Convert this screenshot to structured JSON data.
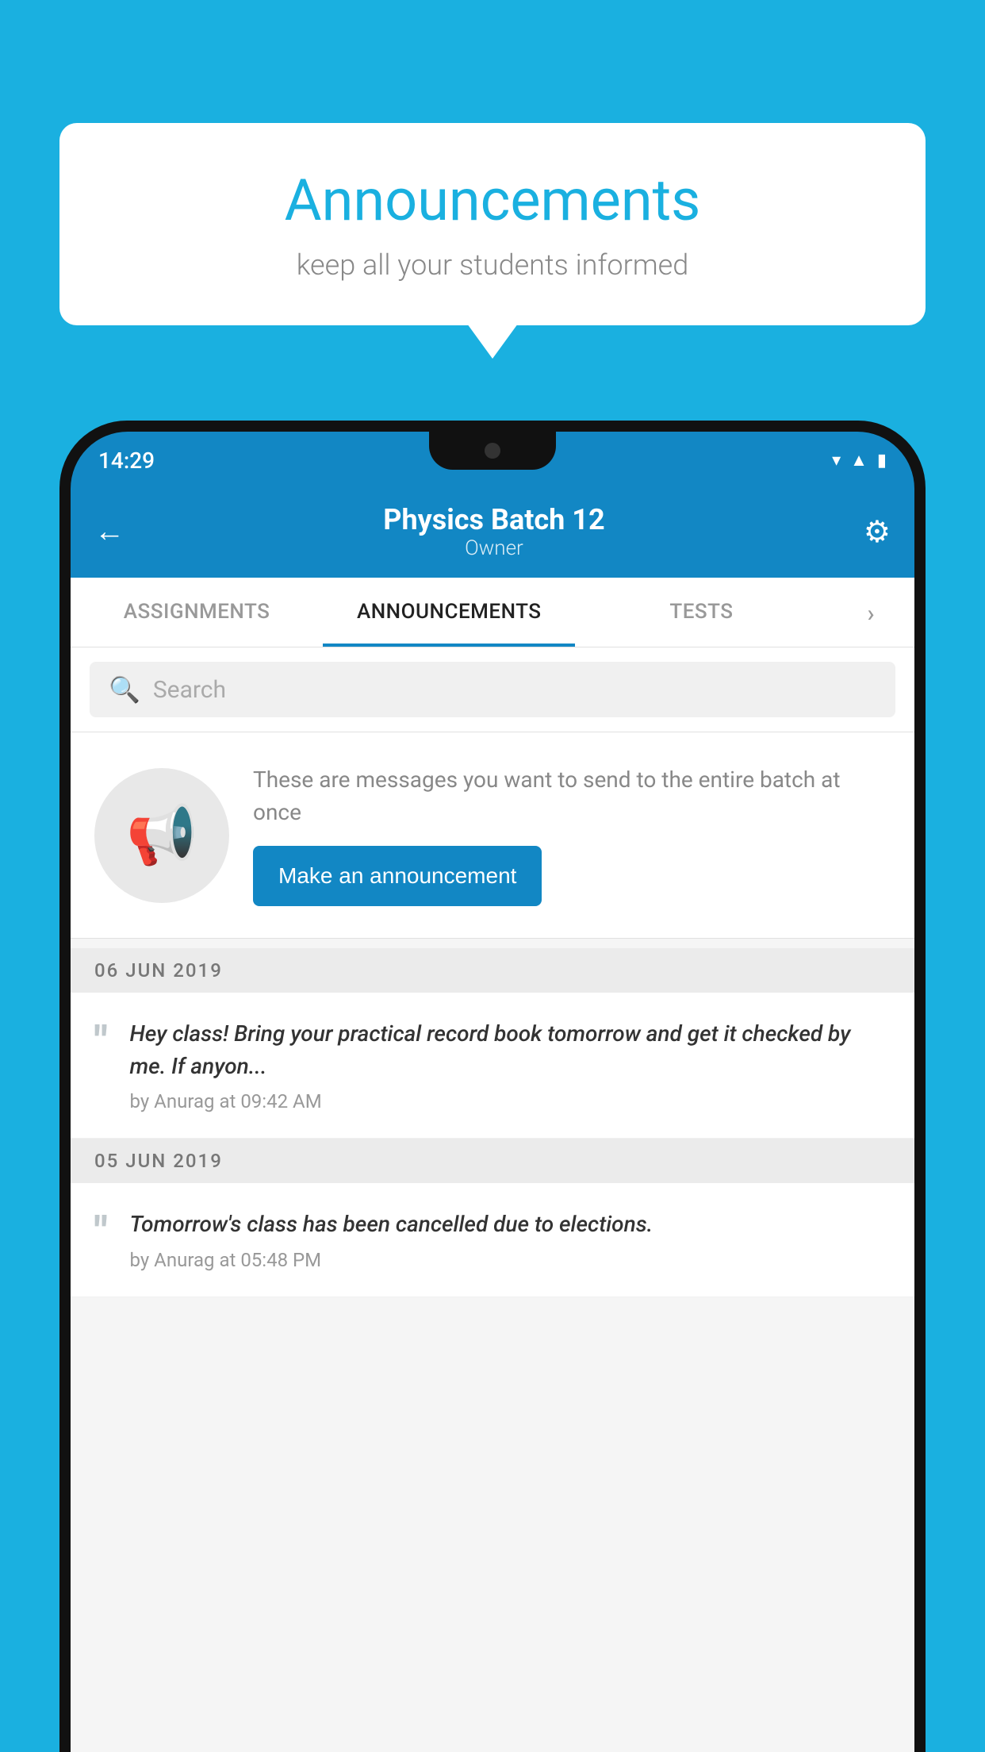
{
  "bubble": {
    "title": "Announcements",
    "subtitle": "keep all your students informed"
  },
  "status_bar": {
    "time": "14:29"
  },
  "header": {
    "title": "Physics Batch 12",
    "subtitle": "Owner",
    "back_label": "←",
    "settings_label": "⚙"
  },
  "tabs": [
    {
      "label": "ASSIGNMENTS",
      "active": false
    },
    {
      "label": "ANNOUNCEMENTS",
      "active": true
    },
    {
      "label": "TESTS",
      "active": false
    },
    {
      "label": "›",
      "active": false
    }
  ],
  "search": {
    "placeholder": "Search"
  },
  "promo": {
    "description": "These are messages you want to\nsend to the entire batch at once",
    "button_label": "Make an announcement"
  },
  "announcements": [
    {
      "date": "06  JUN  2019",
      "text": "Hey class! Bring your practical record book tomorrow and get it checked by me. If anyon...",
      "meta": "by Anurag at 09:42 AM"
    },
    {
      "date": "05  JUN  2019",
      "text": "Tomorrow's class has been cancelled due to elections.",
      "meta": "by Anurag at 05:48 PM"
    }
  ],
  "colors": {
    "brand": "#1ab0e0",
    "header_blue": "#1287c4",
    "button_blue": "#1287c4"
  }
}
